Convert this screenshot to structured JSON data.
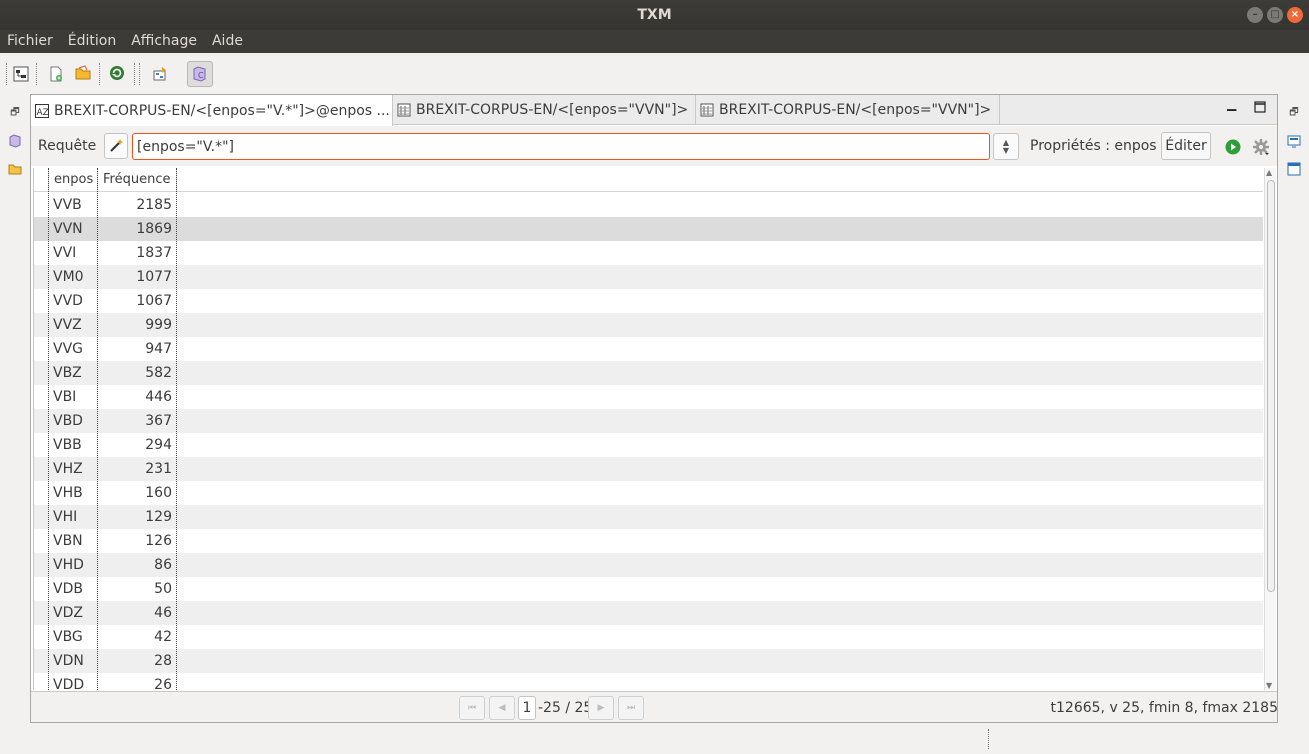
{
  "window": {
    "title": "TXM"
  },
  "menubar": {
    "items": [
      "Fichier",
      "Édition",
      "Affichage",
      "Aide"
    ]
  },
  "toolbar": {
    "icons": [
      "tree-toggle-icon",
      "new-file-icon",
      "open-folder-icon",
      "refresh-icon",
      "import-icon",
      "corpus-view-icon"
    ]
  },
  "tabs": [
    {
      "label": "BREXIT-CORPUS-EN/<[enpos=\"V.*\"]>@enpos ...",
      "icon": "lexicon-icon",
      "active": true,
      "close": "⊠"
    },
    {
      "label": "BREXIT-CORPUS-EN/<[enpos=\"VVN\"]>",
      "icon": "concordance-icon",
      "active": false
    },
    {
      "label": "BREXIT-CORPUS-EN/<[enpos=\"VVN\"]>",
      "icon": "concordance-icon",
      "active": false
    }
  ],
  "query": {
    "label": "Requête",
    "value": "[enpos=\"V.*\"]",
    "properties_label": "Propriétés : enpos",
    "edit_label": "Éditer"
  },
  "table": {
    "columns": [
      "enpos",
      "Fréquence"
    ],
    "rows": [
      {
        "pos": "VVB",
        "freq": "2185"
      },
      {
        "pos": "VVN",
        "freq": "1869"
      },
      {
        "pos": "VVI",
        "freq": "1837"
      },
      {
        "pos": "VM0",
        "freq": "1077"
      },
      {
        "pos": "VVD",
        "freq": "1067"
      },
      {
        "pos": "VVZ",
        "freq": "999"
      },
      {
        "pos": "VVG",
        "freq": "947"
      },
      {
        "pos": "VBZ",
        "freq": "582"
      },
      {
        "pos": "VBI",
        "freq": "446"
      },
      {
        "pos": "VBD",
        "freq": "367"
      },
      {
        "pos": "VBB",
        "freq": "294"
      },
      {
        "pos": "VHZ",
        "freq": "231"
      },
      {
        "pos": "VHB",
        "freq": "160"
      },
      {
        "pos": "VHI",
        "freq": "129"
      },
      {
        "pos": "VBN",
        "freq": "126"
      },
      {
        "pos": "VHD",
        "freq": "86"
      },
      {
        "pos": "VDB",
        "freq": "50"
      },
      {
        "pos": "VDZ",
        "freq": "46"
      },
      {
        "pos": "VBG",
        "freq": "42"
      },
      {
        "pos": "VDN",
        "freq": "28"
      },
      {
        "pos": "VDD",
        "freq": "26"
      }
    ],
    "selected_row": 1
  },
  "pagination": {
    "page": "1",
    "range": "-25 / 25"
  },
  "stats": "t12665, v 25, fmin 8, fmax 2185",
  "colors": {
    "accent": "#e95420",
    "titlebar": "#3c3b37"
  }
}
